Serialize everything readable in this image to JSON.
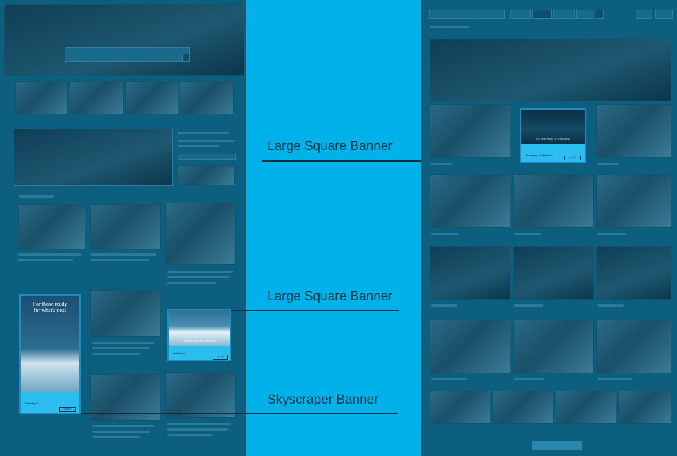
{
  "callouts": {
    "top": "Large Square Banner",
    "middle": "Large Square Banner",
    "bottom": "Skyscraper Banner"
  },
  "ads": {
    "skyscraper": {
      "tagline": "For those ready for what's next",
      "cta": "LEARN"
    },
    "square_left": {
      "tagline": "For those ready for what's next",
      "cta": "LEARN"
    },
    "square_right": {
      "tagline": "For those ready for what's next",
      "cta": "LEARN",
      "brand": "Jameson | Sotheby's"
    }
  },
  "colors": {
    "accent": "#00b1ea",
    "panel": "#0d5f80",
    "ad": "#2bbcf0"
  }
}
